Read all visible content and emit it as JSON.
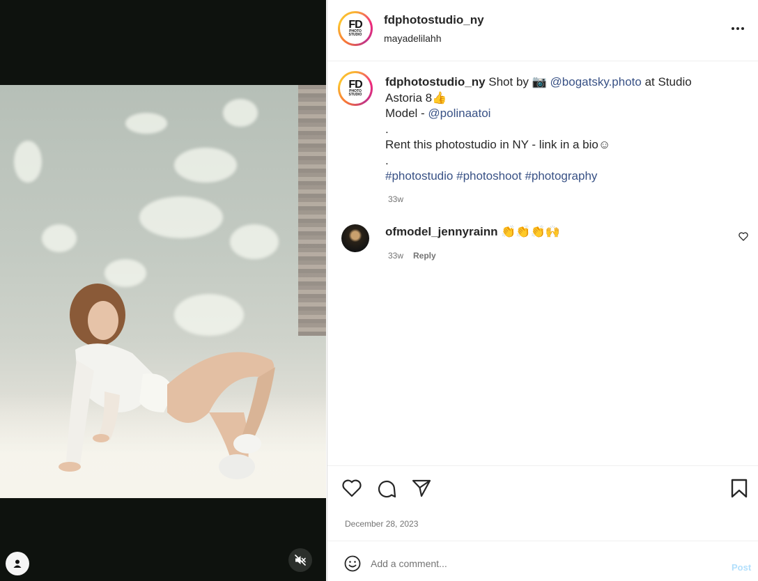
{
  "post": {
    "username": "fdphotostudio_ny",
    "subtitle": "mayadelilahh",
    "logo_main": "FD",
    "logo_sub": "PHOTO STUDIO"
  },
  "caption": {
    "username": "fdphotostudio_ny",
    "text_shot_by": " Shot by 📷 ",
    "mention_photographer": "@bogatsky.photo",
    "text_at_studio": " at Studio Astoria 8👍",
    "model_label": "Model - ",
    "mention_model": "@polinaatoi",
    "dot1": ".",
    "rent_text": "Rent this photostudio in NY - link in a bio☺",
    "dot2": ".",
    "hashtags": [
      "#photostudio",
      "#photoshoot",
      "#photography"
    ],
    "age": "33w"
  },
  "comments": [
    {
      "username": "ofmodel_jennyrainn",
      "text": "👏👏👏🙌",
      "age": "33w",
      "reply_label": "Reply"
    }
  ],
  "date": "December 28, 2023",
  "composer": {
    "placeholder": "Add a comment...",
    "post_label": "Post"
  },
  "icons": {
    "more": "more-options-icon",
    "like": "heart-icon",
    "comment": "comment-bubble-icon",
    "share": "paper-plane-icon",
    "save": "bookmark-icon",
    "emoji": "emoji-icon",
    "mute": "speaker-muted-icon",
    "user": "user-tag-icon"
  },
  "colors": {
    "link": "#385185",
    "muted_text": "#737373",
    "post_disabled": "#b2dffc"
  }
}
